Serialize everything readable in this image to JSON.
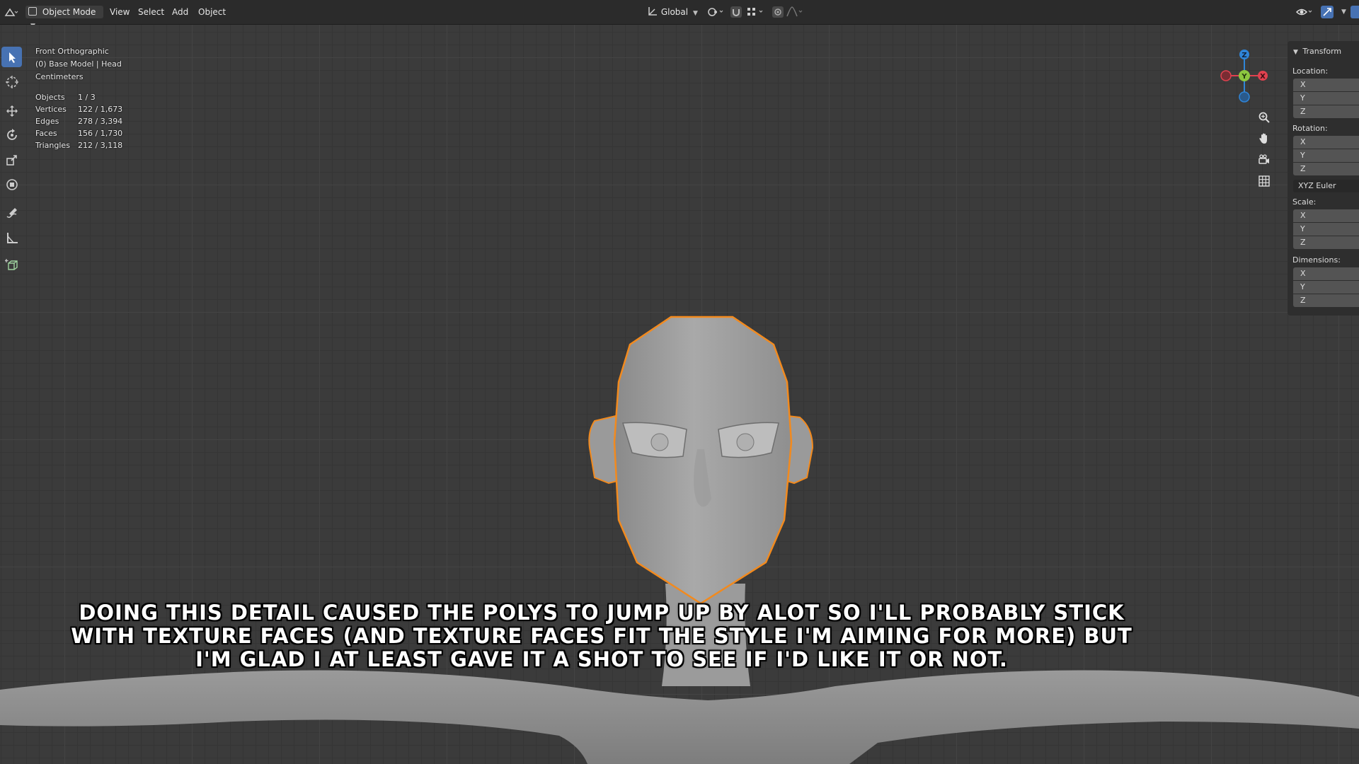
{
  "header": {
    "mode": "Object Mode",
    "menus": [
      "View",
      "Select",
      "Add",
      "Object"
    ],
    "orientation": "Global"
  },
  "overlay": {
    "view_name": "Front Orthographic",
    "object_info": "(0) Base Model | Head",
    "units": "Centimeters",
    "stats": [
      {
        "label": "Objects",
        "value": "1 / 3"
      },
      {
        "label": "Vertices",
        "value": "122 / 1,673"
      },
      {
        "label": "Edges",
        "value": "278 / 3,394"
      },
      {
        "label": "Faces",
        "value": "156 / 1,730"
      },
      {
        "label": "Triangles",
        "value": "212 / 3,118"
      }
    ]
  },
  "gizmo": {
    "z": "Z",
    "y": "Y",
    "x": "X"
  },
  "transform_panel": {
    "title": "Transform",
    "location_label": "Location:",
    "rotation_label": "Rotation:",
    "rotation_mode": "XYZ Euler",
    "scale_label": "Scale:",
    "dimensions_label": "Dimensions:",
    "axes": [
      "X",
      "Y",
      "Z"
    ]
  },
  "colors": {
    "selection_outline": "#f28a1e",
    "active_tool": "#4772b3",
    "axis_x": "#e0414f",
    "axis_y": "#8cc73f",
    "axis_z": "#2f85d8"
  },
  "caption": "Doing this detail caused the polys to jump up by alot so I'll probably stick with texture faces (and texture faces fit the style I'm aiming for more) but I'm glad I at least gave it a shot to see if I'd like it or not."
}
